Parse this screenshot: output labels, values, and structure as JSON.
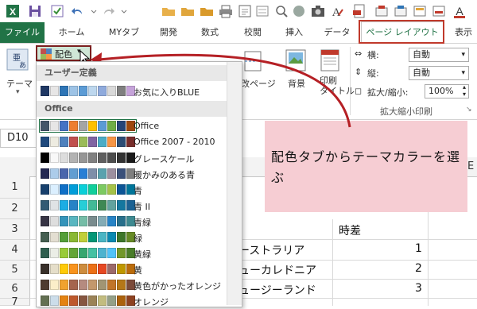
{
  "qat": {
    "icons": [
      "excel-icon",
      "save-icon",
      "check-icon",
      "undo-icon",
      "redo-icon",
      "folder-icon",
      "folder-icon",
      "folder-icon",
      "printer-icon",
      "quick-print-icon",
      "sort-icon",
      "circle-icon",
      "camera-icon",
      "text-icon",
      "pdf-icon",
      "tool-icon",
      "tool-icon",
      "tool-icon",
      "tool-icon"
    ]
  },
  "tabs": [
    "ファイル",
    "ホーム",
    "MYタブ",
    "開発",
    "数式",
    "校閲",
    "挿入",
    "データ",
    "ページ レイアウト",
    "表示"
  ],
  "active_tab": "ページ レイアウト",
  "ribbon": {
    "theme_label": "テーマ",
    "colors_button": "配色",
    "page_break_label": "改ページ",
    "background_label": "背景",
    "print_title_label": "印刷\nタイトル",
    "width_label": "横:",
    "width_value": "自動",
    "height_label": "縦:",
    "height_value": "自動",
    "scale_label": "拡大/縮小:",
    "scale_value": "100%",
    "group_label": "拡大縮小印刷"
  },
  "namebox": "D10",
  "column_letter_e": "E",
  "rows": [
    "1",
    "2",
    "3",
    "4",
    "5",
    "6",
    "7"
  ],
  "cells": {
    "header_jisa": "時差",
    "rows": [
      {
        "country": "ーストラリア",
        "value": "1"
      },
      {
        "country": "ューカレドニア",
        "value": "2"
      },
      {
        "country": "ュージーランド",
        "value": "3"
      }
    ]
  },
  "dropdown": {
    "user_section": "ユーザー定義",
    "user_items": [
      {
        "name": "お気に入りBLUE",
        "colors": [
          "#1f3864",
          "#e7e6e6",
          "#2e75b6",
          "#9dc3e6",
          "#5b9bd5",
          "#bdd7ee",
          "#8faadc",
          "#d9d9d9",
          "#7f7f7f",
          "#c5a3d9"
        ]
      }
    ],
    "office_section": "Office",
    "office_items": [
      {
        "name": "Office",
        "colors": [
          "#44546a",
          "#e7e6e6",
          "#4472c4",
          "#ed7d31",
          "#a5a5a5",
          "#ffc000",
          "#5b9bd5",
          "#70ad47",
          "#264478",
          "#9e480e"
        ]
      },
      {
        "name": "Office 2007 - 2010",
        "colors": [
          "#1f497d",
          "#eeece1",
          "#4f81bd",
          "#c0504d",
          "#9bbb59",
          "#8064a2",
          "#4bacc6",
          "#f79646",
          "#2c4d75",
          "#772c2a"
        ]
      },
      {
        "name": "グレースケール",
        "colors": [
          "#000000",
          "#f8f8f8",
          "#dddddd",
          "#b2b2b2",
          "#969696",
          "#808080",
          "#5f5f5f",
          "#4d4d4d",
          "#333333",
          "#1a1a1a"
        ]
      },
      {
        "name": "暖かみのある青",
        "colors": [
          "#242852",
          "#acccea",
          "#4a66ac",
          "#629dd1",
          "#297fd5",
          "#7f8fa9",
          "#5aa2ae",
          "#9d90a0",
          "#3a507a",
          "#7f7f7f"
        ]
      },
      {
        "name": "青",
        "colors": [
          "#17406d",
          "#dbefff",
          "#0f6fc6",
          "#009dd9",
          "#0bd0d9",
          "#10cf9b",
          "#7cca62",
          "#a5c249",
          "#0c5596",
          "#007599"
        ]
      },
      {
        "name": "青 II",
        "colors": [
          "#335b74",
          "#dfe3e5",
          "#1cade4",
          "#2683c6",
          "#27ced7",
          "#42ba97",
          "#3e8853",
          "#62a39f",
          "#14779f",
          "#1c6293"
        ]
      },
      {
        "name": "青緑",
        "colors": [
          "#373545",
          "#dedede",
          "#3494ba",
          "#58b6c0",
          "#75bda7",
          "#7a8c8e",
          "#84acb6",
          "#2683c6",
          "#276f8b",
          "#3d8990"
        ]
      },
      {
        "name": "緑",
        "colors": [
          "#455f51",
          "#e3ded1",
          "#549e39",
          "#8ab833",
          "#c0cf3a",
          "#029676",
          "#4ab5c4",
          "#0989b1",
          "#3e762a",
          "#678a26"
        ]
      },
      {
        "name": "黄緑",
        "colors": [
          "#2f5f4f",
          "#ebeee6",
          "#99cb38",
          "#63a537",
          "#37a76f",
          "#44c1a3",
          "#4eb3cf",
          "#51c3f9",
          "#72972a",
          "#4a7c29"
        ]
      },
      {
        "name": "黄",
        "colors": [
          "#39302a",
          "#e5dec9",
          "#ffca08",
          "#f8931d",
          "#ce8d3e",
          "#ec7016",
          "#e64823",
          "#9c6a6a",
          "#bf9700",
          "#ba6c0c"
        ]
      },
      {
        "name": "黄色がかったオレンジ",
        "colors": [
          "#4e3b30",
          "#fbeec9",
          "#f0a22e",
          "#a5644e",
          "#b58b80",
          "#c3986d",
          "#a19574",
          "#c17529",
          "#b57718",
          "#7b4b3a"
        ]
      },
      {
        "name": "オレンジ",
        "colors": [
          "#637052",
          "#ccddea",
          "#e48312",
          "#bd582c",
          "#865640",
          "#9b8357",
          "#c2bc80",
          "#94a088",
          "#ab620d",
          "#8d4221"
        ]
      }
    ]
  },
  "callout": "配色タブからテーマカラーを選ぶ",
  "colors": {
    "excel_green": "#217346",
    "highlight_red": "#c0392b",
    "callout_bg": "#f6cdd3"
  }
}
